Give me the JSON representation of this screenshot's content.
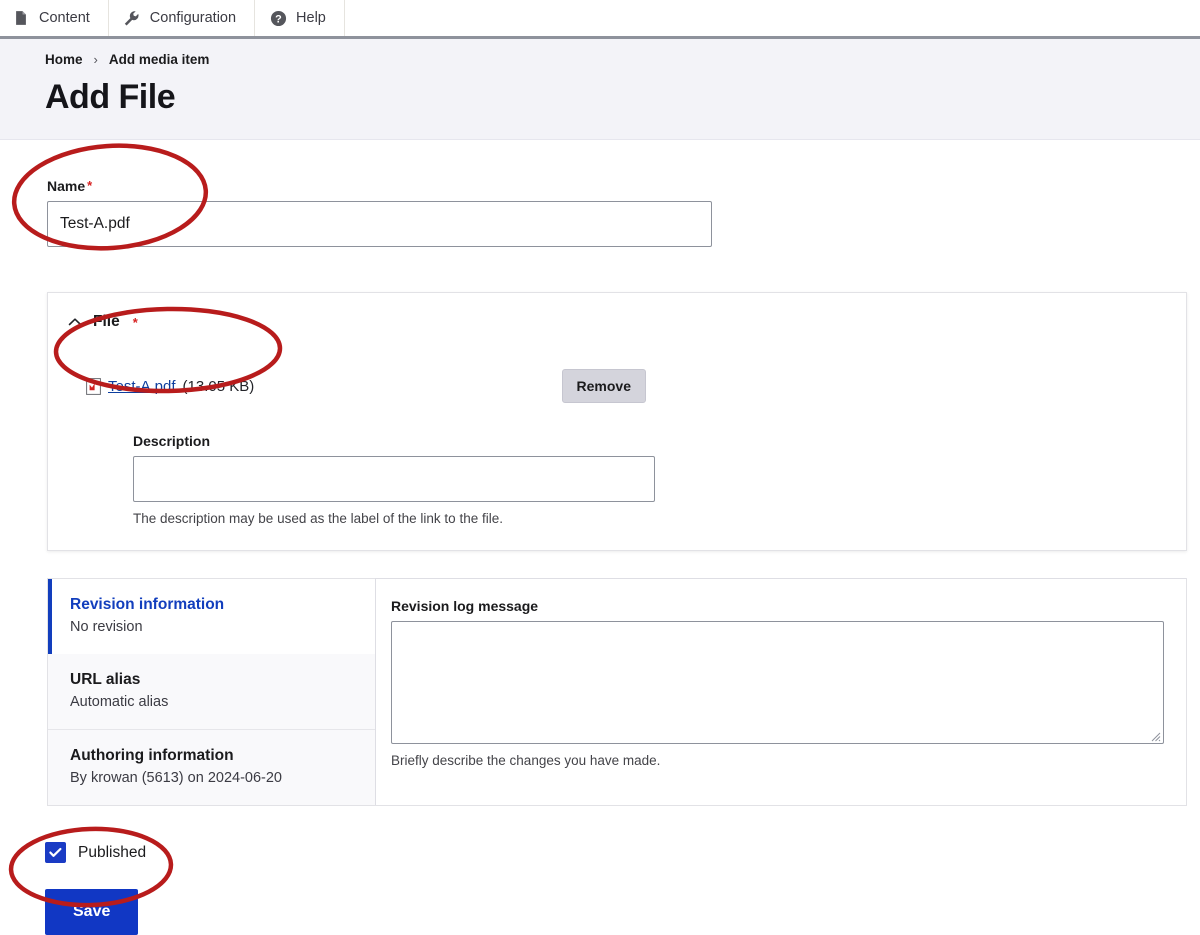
{
  "toolbar": {
    "items": [
      {
        "label": "Content",
        "icon": "document-icon"
      },
      {
        "label": "Configuration",
        "icon": "wrench-icon"
      },
      {
        "label": "Help",
        "icon": "question-circle-icon"
      }
    ]
  },
  "header": {
    "breadcrumb": {
      "home": "Home",
      "separator": "›",
      "current": "Add media item"
    },
    "title": "Add File"
  },
  "name_field": {
    "label": "Name",
    "required_mark": "*",
    "value": "Test-A.pdf",
    "placeholder": ""
  },
  "file_card": {
    "heading": "File",
    "required_mark": "*",
    "collapse_icon": "chevron-up-icon",
    "file": {
      "icon": "pdf-file-icon",
      "name": "Test-A.pdf",
      "size": "(13.05 KB)"
    },
    "remove_label": "Remove",
    "description": {
      "label": "Description",
      "value": "",
      "placeholder": "",
      "help": "The description may be used as the label of the link to the file."
    }
  },
  "vertical_tabs": {
    "items": [
      {
        "title": "Revision information",
        "summary": "No revision",
        "active": true
      },
      {
        "title": "URL alias",
        "summary": "Automatic alias",
        "active": false
      },
      {
        "title": "Authoring information",
        "summary": "By krowan (5613) on 2024-06-20",
        "active": false
      }
    ],
    "panel": {
      "label": "Revision log message",
      "value": "",
      "placeholder": "",
      "help": "Briefly describe the changes you have made."
    }
  },
  "published": {
    "label": "Published",
    "checked": true
  },
  "actions": {
    "save_label": "Save"
  },
  "annotations": {
    "color": "#b81c1c",
    "targets": [
      "name-field",
      "uploaded-file-link",
      "save-button"
    ]
  }
}
